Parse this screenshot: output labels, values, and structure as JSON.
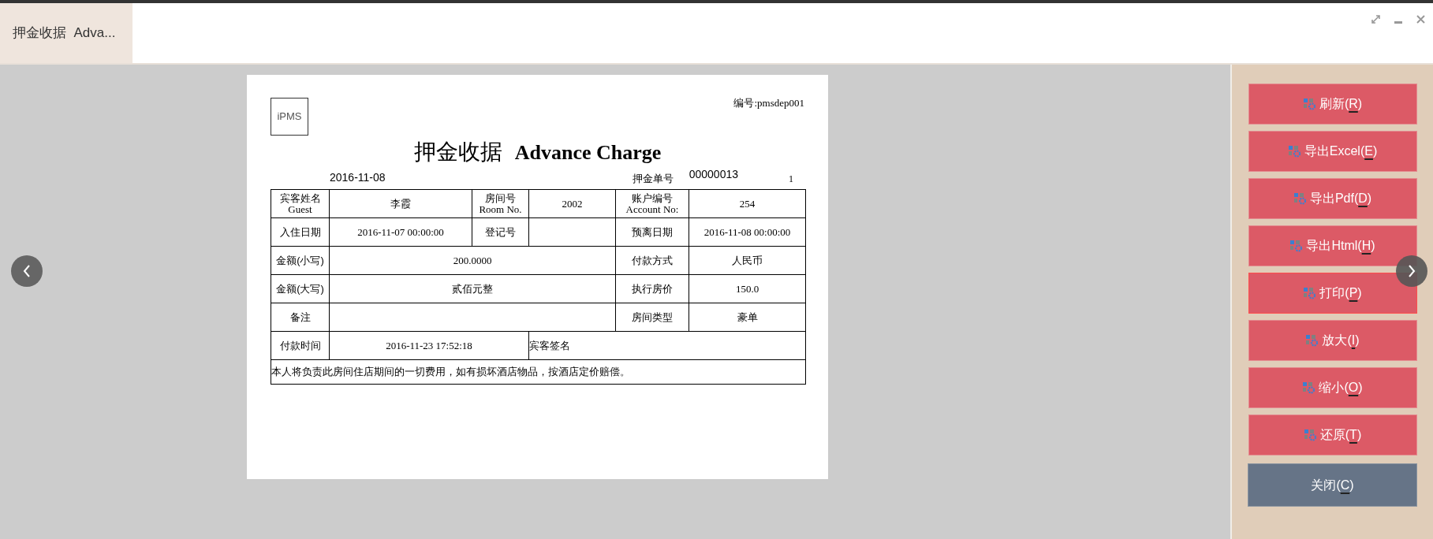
{
  "tab": {
    "label": "押金收据  Adva...",
    "selected": true
  },
  "document": {
    "logo": "iPMS",
    "code": "编号:pmsdep001",
    "title_cn": "押金收据",
    "title_en": "Advance Charge",
    "date": "2016-11-08",
    "number_label": "押金单号",
    "number": "00000013",
    "page": "1",
    "rows": [
      [
        {
          "kind": "label",
          "text": "宾客姓名",
          "sub": "Guest"
        },
        {
          "kind": "value",
          "text": "李霞"
        },
        {
          "kind": "label",
          "text": "房间号",
          "sub": "Room No."
        },
        {
          "kind": "value",
          "text": "2002"
        },
        {
          "kind": "label",
          "text": "账户编号",
          "sub": "Account No:"
        },
        {
          "kind": "value",
          "text": "254"
        }
      ],
      [
        {
          "kind": "label",
          "text": "入住日期"
        },
        {
          "kind": "value",
          "text": "2016-11-07 00:00:00"
        },
        {
          "kind": "label",
          "text": "登记号"
        },
        {
          "kind": "value"
        },
        {
          "kind": "label",
          "text": "预离日期"
        },
        {
          "kind": "value",
          "text": "2016-11-08 00:00:00"
        }
      ]
    ],
    "amount_rows": [
      [
        {
          "kind": "label",
          "text": "金额(小写)"
        },
        {
          "kind": "value",
          "text": "200.0000"
        },
        {
          "kind": "label",
          "text": "付款方式"
        },
        {
          "kind": "value",
          "text": "人民币"
        }
      ],
      [
        {
          "kind": "label",
          "text": "金额(大写)"
        },
        {
          "kind": "value",
          "text": "贰佰元整"
        },
        {
          "kind": "label",
          "text": "执行房价"
        },
        {
          "kind": "value",
          "text": "150.0"
        }
      ],
      [
        {
          "kind": "label",
          "text": "备注"
        },
        {
          "kind": "value"
        },
        {
          "kind": "label",
          "text": "房间类型"
        },
        {
          "kind": "value",
          "text": "豪单"
        }
      ]
    ],
    "payment_time": {
      "label": "付款时间",
      "value": "2016-11-23 17:52:18"
    },
    "signature_label": "宾客签名",
    "statement": "本人将负责此房间住店期间的一切费用，如有损坏酒店物品，按酒店定价赔偿。"
  },
  "buttons": [
    {
      "kind": "action",
      "before": "刷新(",
      "hotkey": "R",
      "after": ")",
      "focused": false
    },
    {
      "kind": "action",
      "before": "导出Excel(",
      "hotkey": "E",
      "after": ")",
      "focused": false
    },
    {
      "kind": "action",
      "before": "导出Pdf(",
      "hotkey": "D",
      "after": ")",
      "focused": false
    },
    {
      "kind": "action",
      "before": "导出Html(",
      "hotkey": "H",
      "after": ")",
      "focused": false
    },
    {
      "kind": "action",
      "before": "打印(",
      "hotkey": "P",
      "after": ")",
      "focused": true
    },
    {
      "kind": "action",
      "before": "放大(",
      "hotkey": "I",
      "after": ")",
      "focused": false
    },
    {
      "kind": "action",
      "before": "缩小(",
      "hotkey": "O",
      "after": ")",
      "focused": false
    },
    {
      "kind": "action",
      "before": "还原(",
      "hotkey": "T",
      "after": ")",
      "focused": false
    },
    {
      "kind": "close",
      "before": "关闭(",
      "hotkey": "C",
      "after": ")"
    }
  ]
}
